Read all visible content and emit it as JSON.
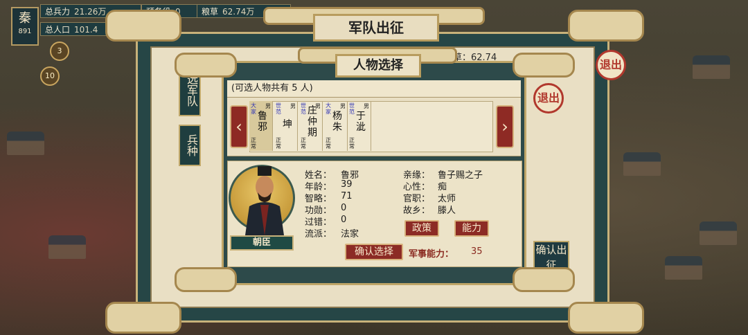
{
  "hud": {
    "state": "秦",
    "state_num": "891",
    "troops_label": "总兵力",
    "troops_value": "21.26万",
    "reserve_label": "预备役",
    "reserve_value": "0",
    "food_label": "粮草",
    "food_value": "62.74万",
    "population_label": "总人口",
    "population_value": "101.4",
    "badge_a": "3",
    "badge_b": "10"
  },
  "outer_panel": {
    "title": "军队出征",
    "tab_army": "选军队",
    "tab_unit": "兵种",
    "food_hint": "前粮草：62.74",
    "confirm_side": "确认出征"
  },
  "modal": {
    "title": "人物选择",
    "count_text": "(可选人物共有  5  人)",
    "prev": "‹",
    "next": "›",
    "characters": [
      {
        "tag": "大家",
        "name": "鲁邪",
        "sex": "男",
        "level": "正常",
        "selected": true
      },
      {
        "tag": "世范",
        "name": "坤",
        "sex": "男",
        "level": "正常",
        "selected": false
      },
      {
        "tag": "世范",
        "name": "庄仲期",
        "sex": "男",
        "level": "正常",
        "selected": false
      },
      {
        "tag": "大家",
        "name": "杨朱",
        "sex": "男",
        "level": "正常",
        "selected": false
      },
      {
        "tag": "世范",
        "name": "于泚",
        "sex": "男",
        "level": "正常",
        "selected": false
      }
    ],
    "detail": {
      "role": "朝臣",
      "name_label": "姓名：",
      "name": "鲁邪",
      "age_label": "年龄：",
      "age": "39",
      "wisdom_label": "智略：",
      "wisdom": "71",
      "merit_label": "功勋：",
      "merit": "0",
      "fault_label": "过错：",
      "fault": "0",
      "school_label": "流派：",
      "school": "法家",
      "kin_label": "亲缘：",
      "kin": "鲁子赐之子",
      "temper_label": "心性：",
      "temper": "痴",
      "office_label": "官职：",
      "office": "太师",
      "home_label": "故乡：",
      "home": "滕人",
      "policy_btn": "政策",
      "ability_btn": "能力",
      "confirm_btn": "确认选择",
      "military_label": "军事能力：",
      "military_value": "35"
    }
  },
  "retreat_label": "退出",
  "colors": {
    "accent_red": "#8c2b25",
    "teal": "#264646",
    "gold": "#c8b27a",
    "paper": "#ece3c8"
  }
}
